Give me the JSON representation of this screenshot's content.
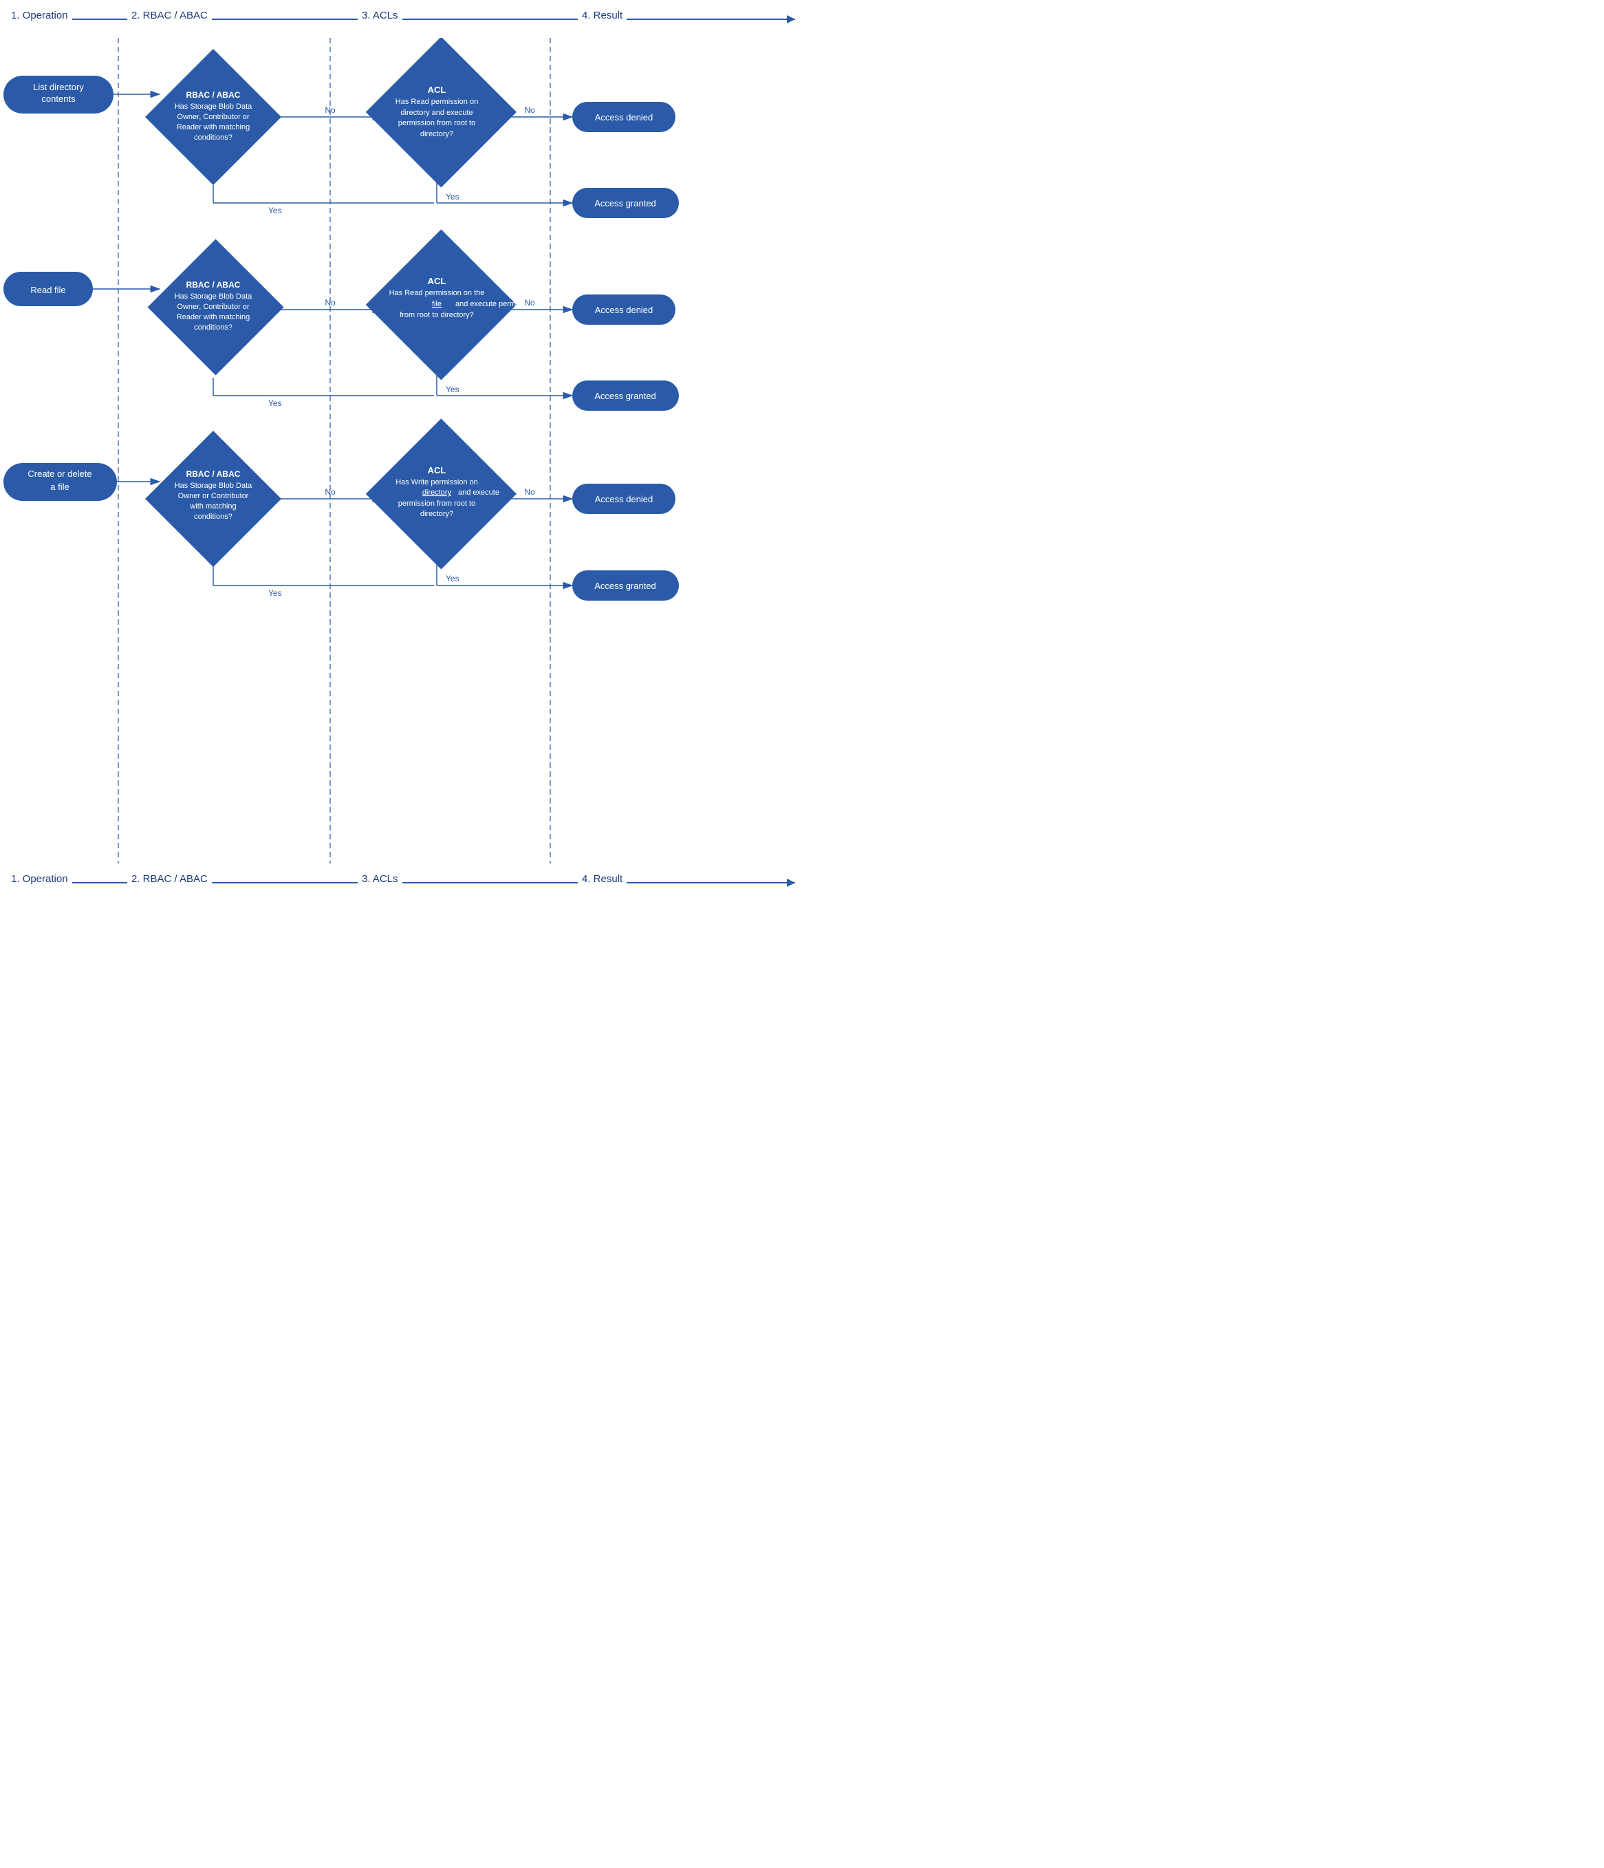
{
  "header": {
    "col1": "1. Operation",
    "col2": "2. RBAC / ABAC",
    "col3": "3. ACLs",
    "col4": "4. Result"
  },
  "footer": {
    "col1": "1. Operation",
    "col2": "2. RBAC / ABAC",
    "col3": "3. ACLs",
    "col4": "4. Result"
  },
  "rows": [
    {
      "id": "row1",
      "operation": "List directory contents",
      "rbac_title": "RBAC / ABAC",
      "rbac_body": "Has Storage Blob Data Owner, Contributor or Reader with matching conditions?",
      "acl_title": "ACL",
      "acl_body": "Has Read permission on directory and execute permission from root to directory?",
      "acl_body_underline": "",
      "denied_label": "Access denied",
      "granted_label": "Access granted",
      "yes_label": "Yes",
      "no_label1": "No",
      "no_label2": "No"
    },
    {
      "id": "row2",
      "operation": "Read file",
      "rbac_title": "RBAC / ABAC",
      "rbac_body": "Has Storage Blob Data Owner, Contributor or Reader with matching conditions?",
      "acl_title": "ACL",
      "acl_body": "Has Read permission on the file and execute permission from root to directory?",
      "acl_body_underline": "file",
      "denied_label": "Access denied",
      "granted_label": "Access granted",
      "yes_label": "Yes",
      "no_label1": "No",
      "no_label2": "No"
    },
    {
      "id": "row3",
      "operation": "Create or delete a file",
      "rbac_title": "RBAC / ABAC",
      "rbac_body": "Has Storage Blob Data Owner or Contributor with matching conditions?",
      "acl_title": "ACL",
      "acl_body": "Has Write permission on directory and execute permission from root to directory?",
      "acl_body_underline": "directory",
      "denied_label": "Access denied",
      "granted_label": "Access granted",
      "yes_label": "Yes",
      "no_label1": "No",
      "no_label2": "No"
    }
  ]
}
